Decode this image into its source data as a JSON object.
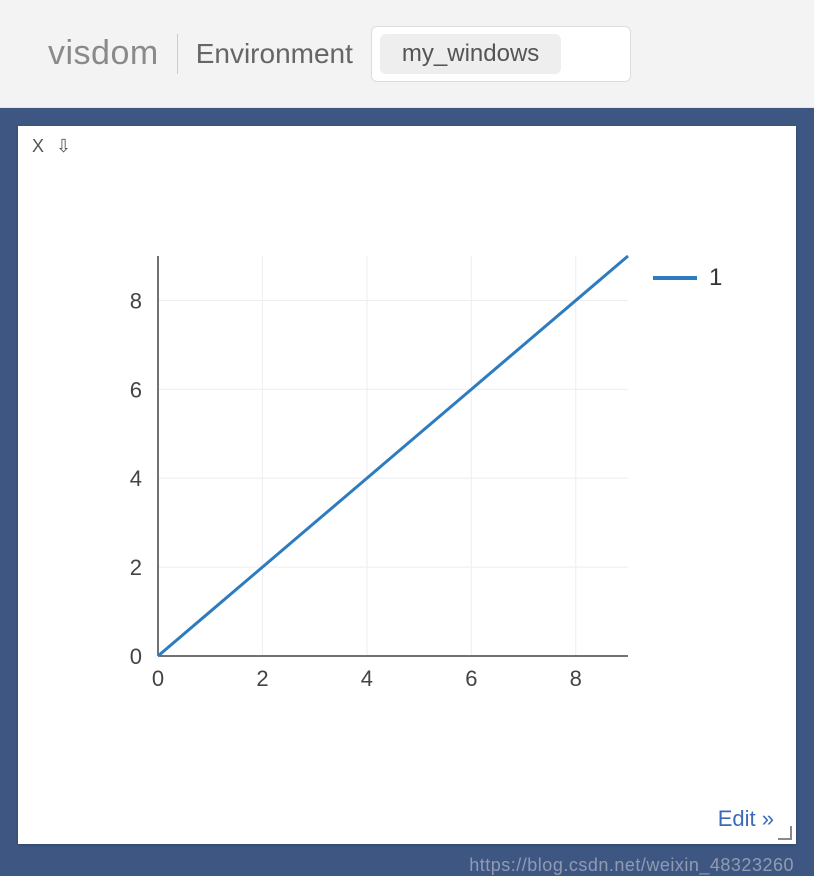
{
  "header": {
    "brand": "visdom",
    "env_label": "Environment",
    "env_selected": "my_windows"
  },
  "panel": {
    "close_icon": "X",
    "download_icon": "⇩",
    "edit_label": "Edit »"
  },
  "legend": {
    "series1": "1"
  },
  "chart_data": {
    "type": "line",
    "series": [
      {
        "name": "1",
        "x": [
          0,
          1,
          2,
          3,
          4,
          5,
          6,
          7,
          8,
          9
        ],
        "y": [
          0,
          1,
          2,
          3,
          4,
          5,
          6,
          7,
          8,
          9
        ],
        "color": "#2e7bbf"
      }
    ],
    "xlabel": "",
    "ylabel": "",
    "xlim": [
      0,
      9
    ],
    "ylim": [
      0,
      9
    ],
    "xticks": [
      0,
      2,
      4,
      6,
      8
    ],
    "yticks": [
      0,
      2,
      4,
      6,
      8
    ],
    "grid": true
  },
  "watermark": "https://blog.csdn.net/weixin_48323260"
}
